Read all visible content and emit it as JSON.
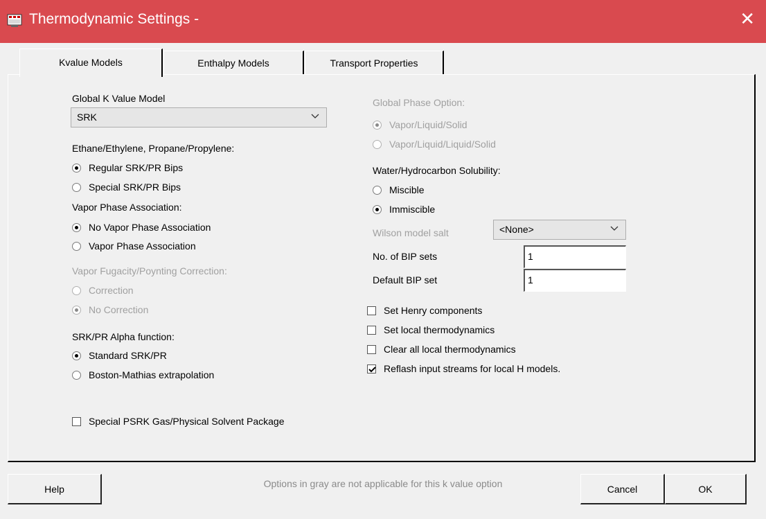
{
  "window": {
    "title": "Thermodynamic Settings -",
    "close_glyph": "✕",
    "titlebar_color": "#d94a4f"
  },
  "tabs": [
    {
      "label": "Kvalue Models",
      "active": true
    },
    {
      "label": "Enthalpy Models",
      "active": false
    },
    {
      "label": "Transport Properties",
      "active": false
    }
  ],
  "left": {
    "global_k": {
      "label": "Global K Value Model",
      "value": "SRK"
    },
    "ethane": {
      "label": "Ethane/Ethylene, Propane/Propylene:",
      "options": [
        "Regular SRK/PR Bips",
        "Special SRK/PR Bips"
      ],
      "selected": 0
    },
    "vapor_assoc": {
      "label": "Vapor Phase Association:",
      "options": [
        "No Vapor Phase Association",
        "Vapor Phase Association"
      ],
      "selected": 0
    },
    "fugacity": {
      "label": "Vapor Fugacity/Poynting Correction:",
      "options": [
        "Correction",
        "No Correction"
      ],
      "selected": 1
    },
    "alpha": {
      "label": "SRK/PR Alpha function:",
      "options": [
        "Standard SRK/PR",
        "Boston-Mathias extrapolation"
      ],
      "selected": 0
    },
    "psrk": {
      "label": "Special PSRK Gas/Physical Solvent Package",
      "checked": false
    }
  },
  "right": {
    "global_phase": {
      "label": "Global Phase Option:",
      "options": [
        "Vapor/Liquid/Solid",
        "Vapor/Liquid/Liquid/Solid"
      ],
      "selected": 0
    },
    "solubility": {
      "label": "Water/Hydrocarbon Solubility:",
      "options": [
        "Miscible",
        "Immiscible"
      ],
      "selected": 1
    },
    "wilson": {
      "label": "Wilson model salt",
      "value": "<None>"
    },
    "bip_sets": {
      "label": "No. of BIP sets",
      "value": "1"
    },
    "default_bip": {
      "label": "Default BIP set",
      "value": "1"
    },
    "checks": [
      {
        "label": "Set Henry components",
        "checked": false
      },
      {
        "label": "Set local thermodynamics",
        "checked": false
      },
      {
        "label": "Clear all local thermodynamics",
        "checked": false
      },
      {
        "label": "Reflash input streams for local H models.",
        "checked": true
      }
    ]
  },
  "footer": {
    "help": "Help",
    "note": "Options in gray are not applicable for this k value option",
    "cancel": "Cancel",
    "ok": "OK"
  }
}
